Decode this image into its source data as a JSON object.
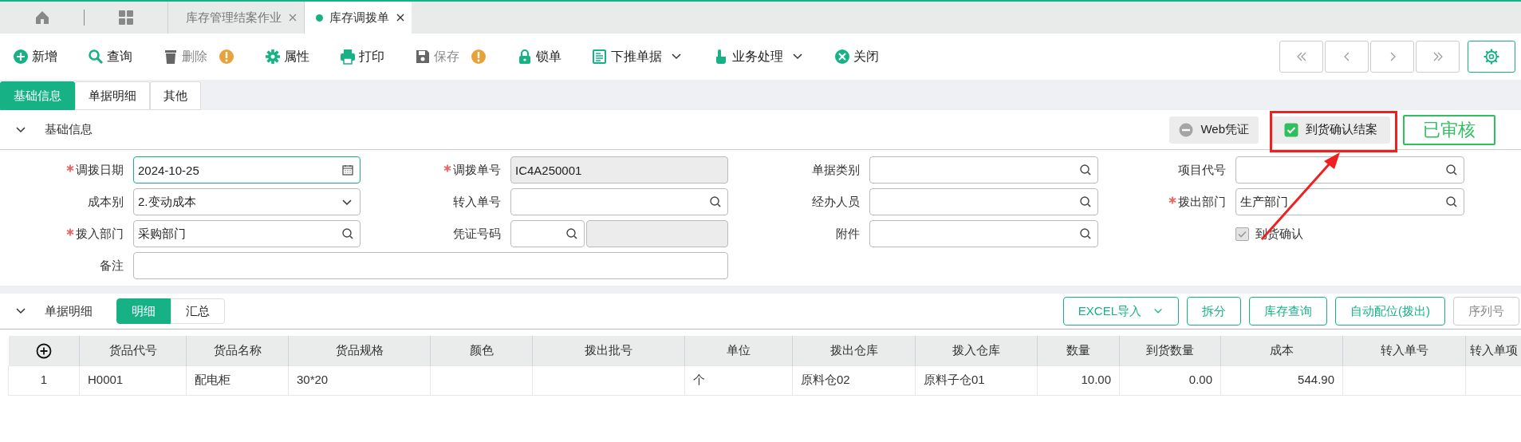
{
  "tabs": [
    {
      "label": "库存管理结案作业",
      "selected": false
    },
    {
      "label": "库存调拨单",
      "selected": true
    }
  ],
  "toolbar": [
    {
      "label": "新增",
      "disabled": false,
      "warning": false,
      "dropdown": false
    },
    {
      "label": "查询",
      "disabled": false,
      "warning": false,
      "dropdown": false
    },
    {
      "label": "删除",
      "disabled": true,
      "warning": true,
      "dropdown": false
    },
    {
      "label": "属性",
      "disabled": false,
      "warning": false,
      "dropdown": false
    },
    {
      "label": "打印",
      "disabled": false,
      "warning": false,
      "dropdown": false
    },
    {
      "label": "保存",
      "disabled": true,
      "warning": true,
      "dropdown": false
    },
    {
      "label": "锁单",
      "disabled": false,
      "warning": false,
      "dropdown": false
    },
    {
      "label": "下推单据",
      "disabled": false,
      "warning": false,
      "dropdown": true
    },
    {
      "label": "业务处理",
      "disabled": false,
      "warning": false,
      "dropdown": true
    },
    {
      "label": "关闭",
      "disabled": false,
      "warning": false,
      "dropdown": false
    }
  ],
  "section_tabs": [
    {
      "label": "基础信息",
      "selected": true
    },
    {
      "label": "单据明细",
      "selected": false
    },
    {
      "label": "其他",
      "selected": false
    }
  ],
  "basic_info": {
    "title": "基础信息",
    "expanded": true,
    "actions": [
      {
        "label": "Web凭证",
        "kind": "voucher"
      },
      {
        "label": "到货确认结案",
        "kind": "check",
        "checked": true
      }
    ],
    "status": "已审核",
    "fields": [
      {
        "label": "调拨日期",
        "required": true,
        "kind": "date",
        "value": "2024-10-25",
        "focused": true
      },
      {
        "label": "调拨单号",
        "required": true,
        "kind": "readonly",
        "value": "IC4A250001"
      },
      {
        "label": "单据类别",
        "required": false,
        "kind": "lookup"
      },
      {
        "label": "项目代号",
        "required": false,
        "kind": "lookup"
      },
      {
        "label": "成本别",
        "required": false,
        "kind": "select",
        "value": "2.变动成本"
      },
      {
        "label": "转入单号",
        "required": false,
        "kind": "lookup"
      },
      {
        "label": "经办人员",
        "required": false,
        "kind": "lookup"
      },
      {
        "label": "拨出部门",
        "required": true,
        "kind": "lookup",
        "value": "生产部门"
      },
      {
        "label": "拨入部门",
        "required": true,
        "kind": "lookup",
        "value": "采购部门"
      },
      {
        "label": "凭证号码",
        "required": false,
        "kind": "voucher"
      },
      {
        "label": "附件",
        "required": false,
        "kind": "lookup"
      },
      {
        "label": "到货确认",
        "kind": "checkbox",
        "checked": true,
        "disabled": true
      },
      {
        "label": "备注",
        "required": false,
        "kind": "note"
      }
    ]
  },
  "detail": {
    "title": "单据明细",
    "expanded": true,
    "views": [
      {
        "label": "明细",
        "selected": true
      },
      {
        "label": "汇总",
        "selected": false
      }
    ],
    "buttons": [
      {
        "label": "EXCEL导入",
        "dropdown": true,
        "disabled": false
      },
      {
        "label": "拆分",
        "dropdown": false,
        "disabled": false
      },
      {
        "label": "库存查询",
        "dropdown": false,
        "disabled": false
      },
      {
        "label": "自动配位(拨出)",
        "dropdown": false,
        "disabled": false
      },
      {
        "label": "序列号",
        "dropdown": false,
        "disabled": true
      }
    ],
    "table": {
      "columns": [
        {
          "label": "货品代号",
          "kind": "text"
        },
        {
          "label": "货品名称",
          "kind": "text"
        },
        {
          "label": "货品规格",
          "kind": "text"
        },
        {
          "label": "颜色",
          "kind": "text"
        },
        {
          "label": "拨出批号",
          "kind": "text"
        },
        {
          "label": "单位",
          "kind": "text"
        },
        {
          "label": "拨出仓库",
          "kind": "text"
        },
        {
          "label": "拨入仓库",
          "kind": "text"
        },
        {
          "label": "数量",
          "kind": "number"
        },
        {
          "label": "到货数量",
          "kind": "number"
        },
        {
          "label": "成本",
          "kind": "number"
        },
        {
          "label": "转入单号",
          "kind": "text"
        },
        {
          "label": "转入单项",
          "kind": "text"
        }
      ],
      "rows": [
        {
          "no": "1",
          "cells": [
            "H0001",
            "配电柜",
            "30*20",
            null,
            null,
            "个",
            "原料仓02",
            "原料子仓01",
            "10.00",
            "0.00",
            "544.90",
            null,
            null
          ]
        }
      ]
    }
  }
}
